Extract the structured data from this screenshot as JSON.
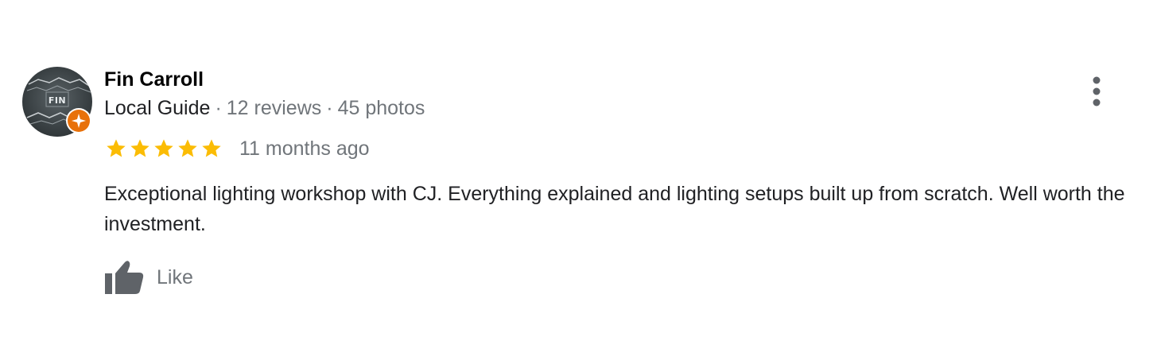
{
  "review": {
    "author": {
      "name": "Fin Carroll",
      "avatar_text": "FIN",
      "guide_label": "Local Guide",
      "reviews": "12 reviews",
      "photos": "45 photos",
      "meta_separator": "·"
    },
    "rating": 5,
    "max_rating": 5,
    "date": "11 months ago",
    "text": "Exceptional lighting workshop with CJ. Everything explained and lighting setups built up from scratch. Well worth the investment.",
    "actions": {
      "like_label": "Like"
    }
  },
  "colors": {
    "star": "#fbbc04",
    "badge": "#e8710a",
    "icon_gray": "#5f6368",
    "muted_text": "#70757a",
    "primary_text": "#202124"
  },
  "icons": {
    "avatar_badge": "local-guide-badge-icon",
    "rating": "star-icon",
    "like": "thumbs-up-icon",
    "more": "more-vert-icon"
  }
}
